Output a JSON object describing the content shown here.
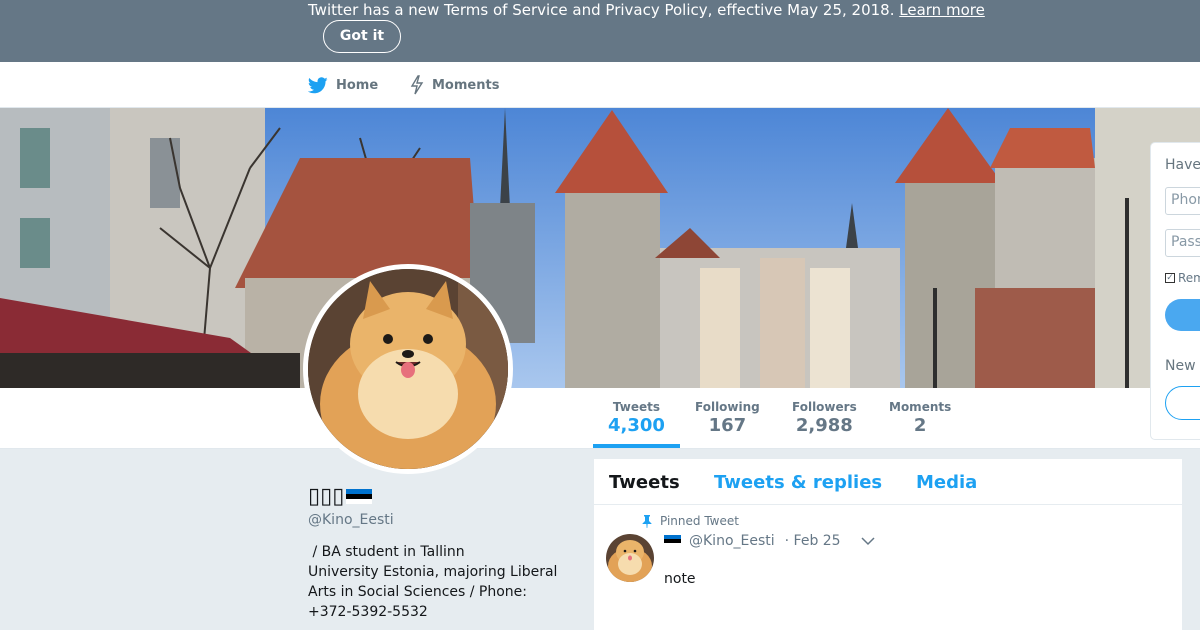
{
  "notice": {
    "text": "Twitter has a new Terms of Service and Privacy Policy, effective May 25, 2018.",
    "link": "Learn more",
    "button": "Got it"
  },
  "nav": {
    "home": "Home",
    "moments": "Moments"
  },
  "stats": [
    {
      "label": "Tweets",
      "value": "4,300"
    },
    {
      "label": "Following",
      "value": "167"
    },
    {
      "label": "Followers",
      "value": "2,988"
    },
    {
      "label": "Moments",
      "value": "2"
    }
  ],
  "profile": {
    "name": "▯▯▯",
    "handle": "@Kino_Eesti",
    "bio_lines": [
      " / BA student in Tallinn",
      "University Estonia, majoring Liberal",
      "Arts in Social Sciences / Phone:",
      "+372-5392-5532"
    ]
  },
  "timeline": {
    "tabs": [
      "Tweets",
      "Tweets & replies",
      "Media"
    ],
    "pinned_label": "Pinned Tweet",
    "tweet": {
      "handle": "@Kino_Eesti",
      "date": "· Feb 25",
      "text": "note"
    }
  },
  "login": {
    "title_partial": "Have",
    "phone_placeholder": "Phon",
    "password_placeholder": "Pass",
    "remember_partial": "Rem",
    "new_partial": "New"
  },
  "colors": {
    "accent": "#1da1f2",
    "notice_bg": "#657786",
    "flag": [
      "#0072ce",
      "#000000",
      "#ffffff"
    ]
  }
}
